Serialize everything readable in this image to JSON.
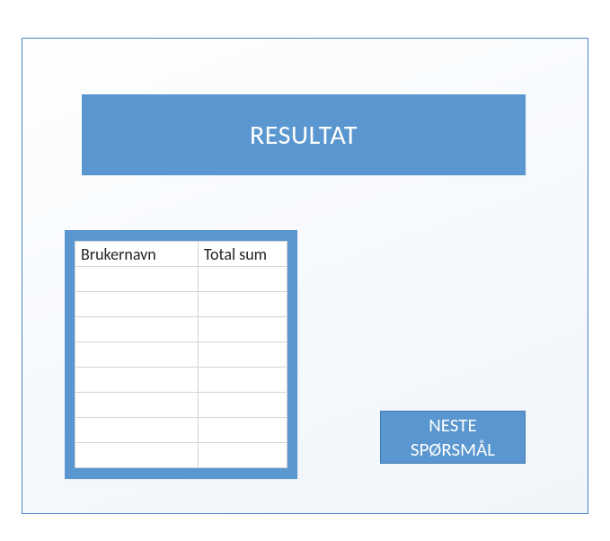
{
  "title": "RESULTAT",
  "table": {
    "headers": {
      "username": "Brukernavn",
      "total": "Total sum"
    },
    "rows": [
      {
        "username": "",
        "total": ""
      },
      {
        "username": "",
        "total": ""
      },
      {
        "username": "",
        "total": ""
      },
      {
        "username": "",
        "total": ""
      },
      {
        "username": "",
        "total": ""
      },
      {
        "username": "",
        "total": ""
      },
      {
        "username": "",
        "total": ""
      },
      {
        "username": "",
        "total": ""
      }
    ]
  },
  "buttons": {
    "next": "NESTE\nSPØRSMÅL"
  },
  "colors": {
    "accent": "#5a96cf",
    "border": "#4a87c7",
    "cell_border": "#d4d4d4"
  }
}
